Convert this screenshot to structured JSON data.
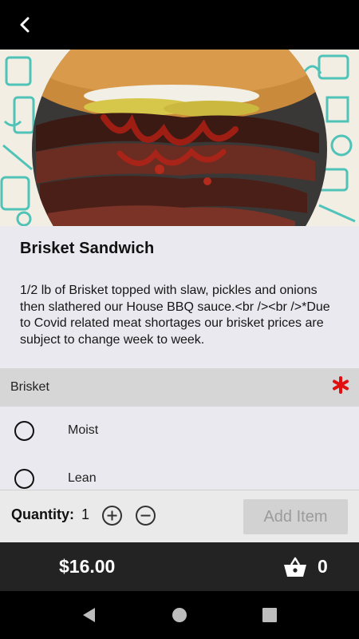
{
  "item": {
    "title": "Brisket Sandwich",
    "description": "1/2 lb of Brisket topped with slaw, pickles and onions then slathered our House BBQ sauce.<br /><br />*Due to Covid related meat shortages our brisket prices are subject to change week to week."
  },
  "options": {
    "group_label": "Brisket",
    "required_color": "#e01010",
    "choices": [
      {
        "label": "Moist"
      },
      {
        "label": "Lean"
      }
    ]
  },
  "quantity": {
    "label": "Quantity:",
    "value": "1",
    "add_label": "Add Item"
  },
  "summary": {
    "price": "$16.00",
    "cart_count": "0"
  },
  "icons": {
    "back": "chevron-left-icon",
    "increment": "plus-circle-icon",
    "decrement": "minus-circle-icon",
    "cart": "shopping-basket-icon",
    "nav_back": "triangle-back-icon",
    "nav_home": "circle-home-icon",
    "nav_recents": "square-recents-icon"
  },
  "colors": {
    "accent_bar": "#232323",
    "pattern": "#3fbfb4"
  }
}
